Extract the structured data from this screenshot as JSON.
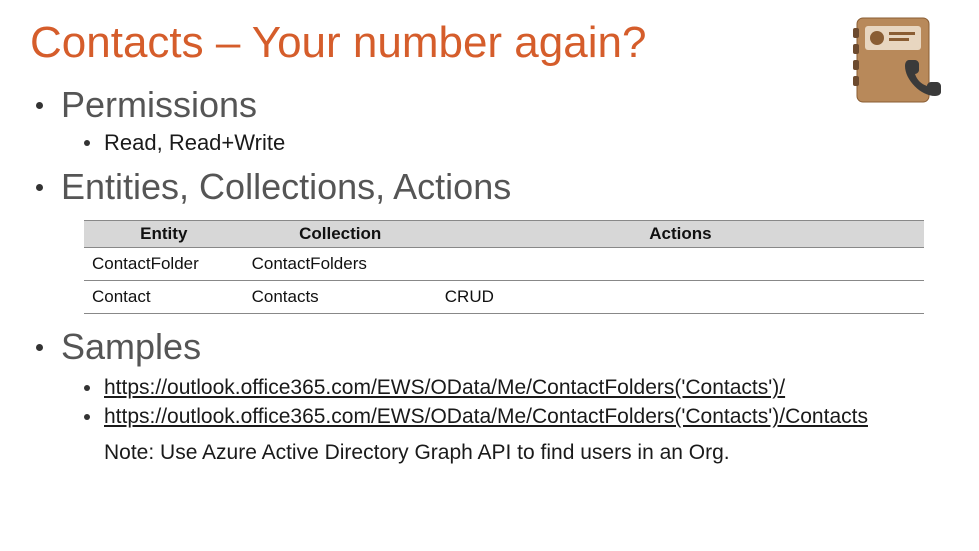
{
  "title": "Contacts – Your number again?",
  "sections": {
    "permissions": {
      "heading": "Permissions",
      "sub": "Read, Read+Write"
    },
    "entities": {
      "heading": "Entities, Collections, Actions",
      "table": {
        "headers": [
          "Entity",
          "Collection",
          "Actions"
        ],
        "rows": [
          {
            "entity": "ContactFolder",
            "collection": "ContactFolders",
            "actions": ""
          },
          {
            "entity": "Contact",
            "collection": "Contacts",
            "actions": "CRUD"
          }
        ]
      }
    },
    "samples": {
      "heading": "Samples",
      "links": [
        "https://outlook.office365.com/EWS/OData/Me/ContactFolders('Contacts')/",
        "https://outlook.office365.com/EWS/OData/Me/ContactFolders('Contacts')/Contacts"
      ],
      "note": "Note: Use Azure Active Directory Graph API to find users in an Org."
    }
  },
  "icon": "contacts-book-phone-icon"
}
